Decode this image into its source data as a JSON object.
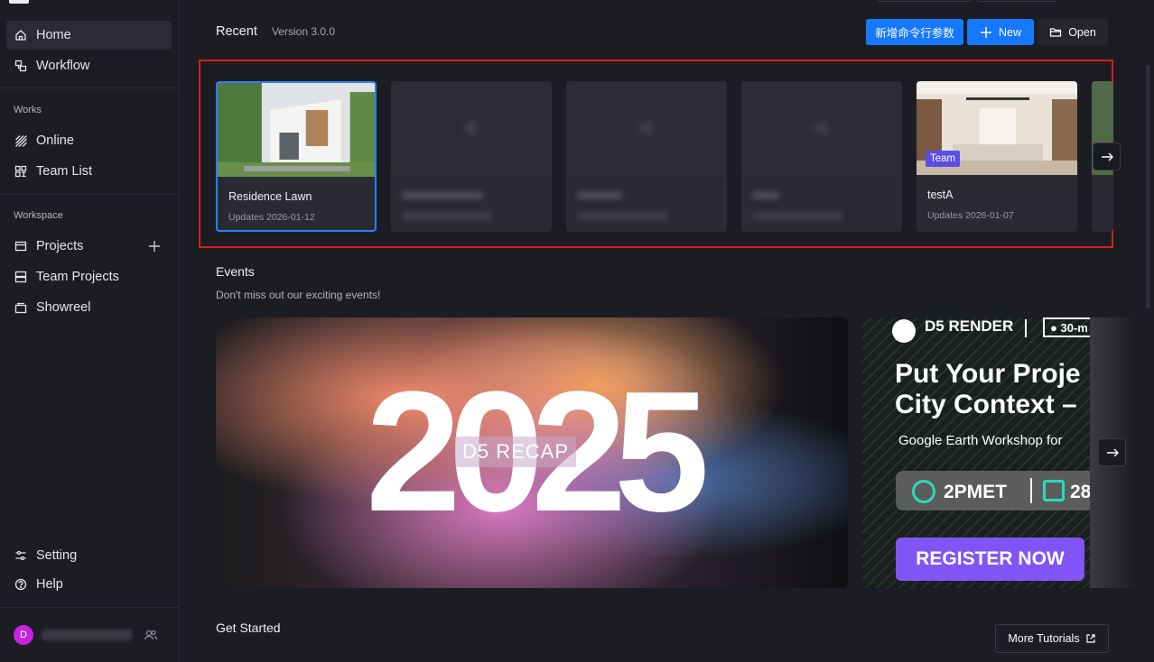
{
  "sidebar": {
    "home": "Home",
    "workflow": "Workflow",
    "works_heading": "Works",
    "online": "Online",
    "team_list": "Team List",
    "workspace_heading": "Workspace",
    "projects": "Projects",
    "team_projects": "Team Projects",
    "showreel": "Showreel",
    "setting": "Setting",
    "help": "Help",
    "avatar_initial": "D"
  },
  "header": {
    "recent": "Recent",
    "version": "Version 3.0.0",
    "cmd_button": "新增命令行参数",
    "new_button": "New",
    "open_button": "Open"
  },
  "recent_cards": [
    {
      "title": "Residence Lawn",
      "updated": "Updates 2026-01-12",
      "selected": true
    },
    {
      "title": "",
      "updated": "",
      "blurred": true
    },
    {
      "title": "",
      "updated": "",
      "blurred": true
    },
    {
      "title": "",
      "updated": "",
      "blurred": true
    },
    {
      "title": "testA",
      "updated": "Updates 2026-01-07",
      "badge": "Team"
    }
  ],
  "events": {
    "title": "Events",
    "subtitle": "Don't miss out our exciting events!",
    "banner1_big": "2025",
    "banner1_recap": "D5 RECAP",
    "banner2_brand": "D5 RENDER",
    "banner2_tag": "● 30-m",
    "banner2_headline_1": "Put Your Proje",
    "banner2_headline_2": "City Context –",
    "banner2_sub": "Google Earth Workshop for",
    "banner2_time": "2PMET",
    "banner2_date": "28",
    "banner2_register": "REGISTER NOW"
  },
  "get_started": {
    "title": "Get Started",
    "more_tutorials": "More Tutorials"
  },
  "colors": {
    "accent": "#1677ff",
    "highlight": "#d62020",
    "team_badge": "#5b4ee3",
    "register": "#8155f5"
  }
}
